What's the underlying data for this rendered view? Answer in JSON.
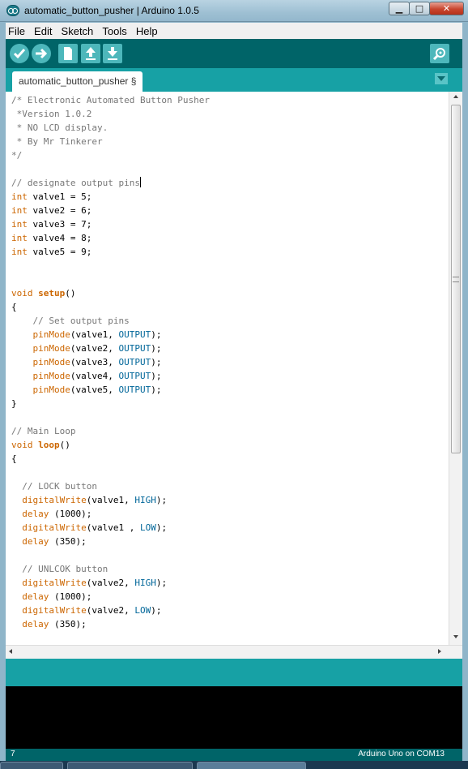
{
  "window": {
    "title": "automatic_button_pusher | Arduino 1.0.5",
    "min_symbol": "▁",
    "max_symbol": "□",
    "close_symbol": "✕"
  },
  "menu": [
    "File",
    "Edit",
    "Sketch",
    "Tools",
    "Help"
  ],
  "toolbar": {
    "buttons": [
      "verify-icon",
      "upload-icon",
      "new-icon",
      "open-icon",
      "save-icon"
    ],
    "serial_monitor": "serial-monitor-icon"
  },
  "tab": {
    "label": "automatic_button_pusher §"
  },
  "code_lines": [
    [
      {
        "t": "/* Electronic Automated Button Pusher",
        "c": "comment"
      }
    ],
    [
      {
        "t": " *Version 1.0.2",
        "c": "comment"
      }
    ],
    [
      {
        "t": " * NO LCD display.",
        "c": "comment"
      }
    ],
    [
      {
        "t": " * By Mr Tinkerer",
        "c": "comment"
      }
    ],
    [
      {
        "t": "*/",
        "c": "comment"
      }
    ],
    [],
    [
      {
        "t": "// designate output pins",
        "c": "comment"
      },
      {
        "t": "",
        "c": "cursor"
      }
    ],
    [
      {
        "t": "int",
        "c": "type"
      },
      {
        "t": " valve1 = 5;",
        "c": ""
      }
    ],
    [
      {
        "t": "int",
        "c": "type"
      },
      {
        "t": " valve2 = 6;",
        "c": ""
      }
    ],
    [
      {
        "t": "int",
        "c": "type"
      },
      {
        "t": " valve3 = 7;",
        "c": ""
      }
    ],
    [
      {
        "t": "int",
        "c": "type"
      },
      {
        "t": " valve4 = 8;",
        "c": ""
      }
    ],
    [
      {
        "t": "int",
        "c": "type"
      },
      {
        "t": " valve5 = 9;",
        "c": ""
      }
    ],
    [],
    [],
    [
      {
        "t": "void",
        "c": "type"
      },
      {
        "t": " ",
        "c": ""
      },
      {
        "t": "setup",
        "c": "bold"
      },
      {
        "t": "()",
        "c": ""
      }
    ],
    [
      {
        "t": "{",
        "c": ""
      }
    ],
    [
      {
        "t": "    // Set output pins",
        "c": "comment"
      }
    ],
    [
      {
        "t": "    ",
        "c": ""
      },
      {
        "t": "pinMode",
        "c": "func"
      },
      {
        "t": "(valve1, ",
        "c": ""
      },
      {
        "t": "OUTPUT",
        "c": "const"
      },
      {
        "t": ");",
        "c": ""
      }
    ],
    [
      {
        "t": "    ",
        "c": ""
      },
      {
        "t": "pinMode",
        "c": "func"
      },
      {
        "t": "(valve2, ",
        "c": ""
      },
      {
        "t": "OUTPUT",
        "c": "const"
      },
      {
        "t": ");",
        "c": ""
      }
    ],
    [
      {
        "t": "    ",
        "c": ""
      },
      {
        "t": "pinMode",
        "c": "func"
      },
      {
        "t": "(valve3, ",
        "c": ""
      },
      {
        "t": "OUTPUT",
        "c": "const"
      },
      {
        "t": ");",
        "c": ""
      }
    ],
    [
      {
        "t": "    ",
        "c": ""
      },
      {
        "t": "pinMode",
        "c": "func"
      },
      {
        "t": "(valve4, ",
        "c": ""
      },
      {
        "t": "OUTPUT",
        "c": "const"
      },
      {
        "t": ");",
        "c": ""
      }
    ],
    [
      {
        "t": "    ",
        "c": ""
      },
      {
        "t": "pinMode",
        "c": "func"
      },
      {
        "t": "(valve5, ",
        "c": ""
      },
      {
        "t": "OUTPUT",
        "c": "const"
      },
      {
        "t": ");",
        "c": ""
      }
    ],
    [
      {
        "t": "}",
        "c": ""
      }
    ],
    [],
    [
      {
        "t": "// Main Loop",
        "c": "comment"
      }
    ],
    [
      {
        "t": "void",
        "c": "type"
      },
      {
        "t": " ",
        "c": ""
      },
      {
        "t": "loop",
        "c": "bold"
      },
      {
        "t": "()",
        "c": ""
      }
    ],
    [
      {
        "t": "{",
        "c": ""
      }
    ],
    [],
    [
      {
        "t": "  // LOCK button",
        "c": "comment"
      }
    ],
    [
      {
        "t": "  ",
        "c": ""
      },
      {
        "t": "digitalWrite",
        "c": "func"
      },
      {
        "t": "(valve1, ",
        "c": ""
      },
      {
        "t": "HIGH",
        "c": "const"
      },
      {
        "t": ");",
        "c": ""
      }
    ],
    [
      {
        "t": "  ",
        "c": ""
      },
      {
        "t": "delay",
        "c": "func"
      },
      {
        "t": " (1000);",
        "c": ""
      }
    ],
    [
      {
        "t": "  ",
        "c": ""
      },
      {
        "t": "digitalWrite",
        "c": "func"
      },
      {
        "t": "(valve1 , ",
        "c": ""
      },
      {
        "t": "LOW",
        "c": "const"
      },
      {
        "t": ");",
        "c": ""
      }
    ],
    [
      {
        "t": "  ",
        "c": ""
      },
      {
        "t": "delay",
        "c": "func"
      },
      {
        "t": " (350);",
        "c": ""
      }
    ],
    [],
    [
      {
        "t": "  // UNLCOK button",
        "c": "comment"
      }
    ],
    [
      {
        "t": "  ",
        "c": ""
      },
      {
        "t": "digitalWrite",
        "c": "func"
      },
      {
        "t": "(valve2, ",
        "c": ""
      },
      {
        "t": "HIGH",
        "c": "const"
      },
      {
        "t": ");",
        "c": ""
      }
    ],
    [
      {
        "t": "  ",
        "c": ""
      },
      {
        "t": "delay",
        "c": "func"
      },
      {
        "t": " (1000);",
        "c": ""
      }
    ],
    [
      {
        "t": "  ",
        "c": ""
      },
      {
        "t": "digitalWrite",
        "c": "func"
      },
      {
        "t": "(valve2, ",
        "c": ""
      },
      {
        "t": "LOW",
        "c": "const"
      },
      {
        "t": ");",
        "c": ""
      }
    ],
    [
      {
        "t": "  ",
        "c": ""
      },
      {
        "t": "delay",
        "c": "func"
      },
      {
        "t": " (350);",
        "c": ""
      }
    ]
  ],
  "status": {
    "line_number": "7",
    "board": "Arduino Uno on COM13"
  },
  "colors": {
    "toolbar": "#006468",
    "tabbar": "#17a1a5",
    "keyword": "#cc6600",
    "constant": "#006699",
    "comment": "#777777"
  }
}
